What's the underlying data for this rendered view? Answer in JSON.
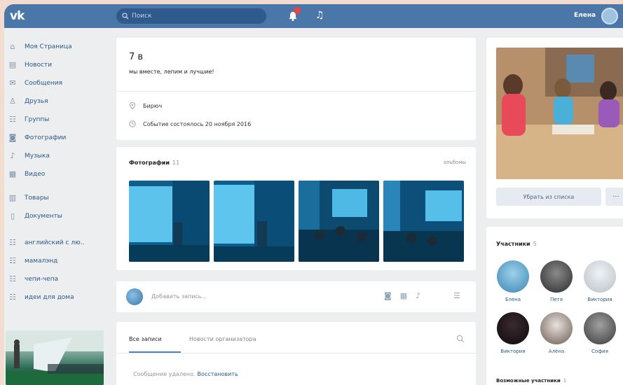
{
  "header": {
    "logo": "vk",
    "search_placeholder": "Поиск",
    "user_name": "Елена"
  },
  "sidebar": {
    "items": [
      {
        "label": "Моя Страница",
        "icon": "home-icon"
      },
      {
        "label": "Новости",
        "icon": "news-icon"
      },
      {
        "label": "Сообщения",
        "icon": "messages-icon"
      },
      {
        "label": "Друзья",
        "icon": "friends-icon"
      },
      {
        "label": "Группы",
        "icon": "groups-icon"
      },
      {
        "label": "Фотографии",
        "icon": "photos-icon"
      },
      {
        "label": "Музыка",
        "icon": "music-icon"
      },
      {
        "label": "Видео",
        "icon": "video-icon"
      }
    ],
    "items2": [
      {
        "label": "Товары",
        "icon": "goods-icon"
      },
      {
        "label": "Документы",
        "icon": "documents-icon"
      }
    ],
    "groups": [
      {
        "label": "английский с лю..",
        "icon": "group-icon"
      },
      {
        "label": "мамалэнд",
        "icon": "group-icon"
      },
      {
        "label": "чепи-чепа",
        "icon": "group-icon"
      },
      {
        "label": "идеи для дома",
        "icon": "group-icon"
      }
    ]
  },
  "event": {
    "title": "7 в",
    "subtitle": "мы вместе, лепим и лучшие!",
    "location": "Бирюч",
    "date": "Событие состоялось 20 ноября 2016"
  },
  "photos": {
    "title": "Фотографии",
    "count": "11",
    "all_label": "альбомы"
  },
  "compose": {
    "placeholder": "Добавить запись..."
  },
  "wall": {
    "tab_all": "Все записи",
    "tab_org": "Новости организатора",
    "deleted_msg": "Сообщение удалено.",
    "restore_link": "Восстановить"
  },
  "cover": {
    "remove_button": "Убрать из списка",
    "more_button": "···"
  },
  "members": {
    "title": "Участники",
    "count": "5",
    "list": [
      {
        "name": "Елена",
        "color": "#6aa7c9"
      },
      {
        "name": "Петя",
        "color": "#4a4a4a"
      },
      {
        "name": "Виктория",
        "color": "#c8ccd2"
      },
      {
        "name": "Виктория",
        "color": "#1f1a1e"
      },
      {
        "name": "Алёна",
        "color": "#6a5a55"
      },
      {
        "name": "София",
        "color": "#5a5a5a"
      }
    ],
    "maybe_title": "Возможные участники",
    "maybe_count": "1"
  },
  "colors": {
    "header": "#4a76a8",
    "link": "#2a5885",
    "page_bg": "#edeef0"
  }
}
